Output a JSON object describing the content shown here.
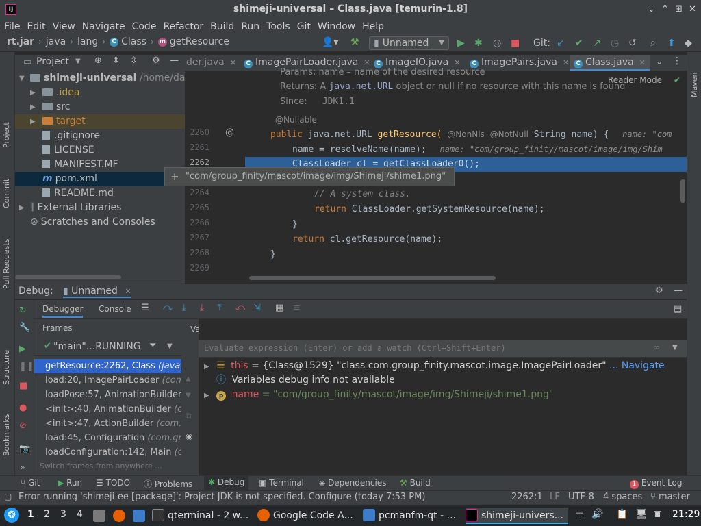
{
  "window": {
    "title": "shimeji-universal – Class.java [temurin-1.8]",
    "app_icon": "IJ"
  },
  "menu": [
    "File",
    "Edit",
    "View",
    "Navigate",
    "Code",
    "Refactor",
    "Build",
    "Run",
    "Tools",
    "Git",
    "Window",
    "Help"
  ],
  "breadcrumb": {
    "items": [
      "rt.jar",
      "java",
      "lang",
      "Class",
      "getResource"
    ]
  },
  "toolbar": {
    "run_config": "Unnamed",
    "git_label": "Git:"
  },
  "left_strip": [
    "Project",
    "Commit",
    "Pull Requests",
    "Structure",
    "Bookmarks"
  ],
  "right_strip": [
    "Maven"
  ],
  "project": {
    "header": "Project",
    "tree": [
      {
        "label": "shimeji-universal",
        "detail": "/home/dartz",
        "type": "root"
      },
      {
        "label": ".idea",
        "type": "folder"
      },
      {
        "label": "src",
        "type": "folder"
      },
      {
        "label": "target",
        "type": "folder-excluded"
      },
      {
        "label": ".gitignore",
        "type": "file"
      },
      {
        "label": "LICENSE",
        "type": "file"
      },
      {
        "label": "MANIFEST.MF",
        "type": "file"
      },
      {
        "label": "pom.xml",
        "type": "file-selected"
      },
      {
        "label": "README.md",
        "type": "file"
      },
      {
        "label": "External Libraries",
        "type": "library"
      },
      {
        "label": "Scratches and Consoles",
        "type": "scratch"
      }
    ]
  },
  "tabs": [
    "der.java",
    "ImagePairLoader.java",
    "ImageIO.java",
    "ImagePairs.java",
    "Class.java"
  ],
  "editor": {
    "reader_mode": "Reader Mode",
    "doc_params": "Params: name – name of the desired resource",
    "doc_returns_prefix": "Returns: A",
    "doc_returns_code": "java.net.URL",
    "doc_returns_suffix": "object or null if no resource with this name is found",
    "doc_since_label": "Since:",
    "doc_since_value": "JDK1.1",
    "nullable": "@Nullable",
    "line_numbers": [
      "2260",
      "2261",
      "2262",
      "2263",
      "2264",
      "2265",
      "2266",
      "2267",
      "2268",
      "2269"
    ],
    "l2260_kw": "public",
    "l2260_type": "java.net.URL",
    "l2260_fn": "getResource(",
    "l2260_ann1": "@NonNls",
    "l2260_ann2": "@NotNull",
    "l2260_param": "String name) {",
    "l2260_hint": "name: \"com",
    "l2261_code": "name = resolveName(name);",
    "l2261_hint": "name: \"com/group_finity/mascot/image/img/Shim",
    "l2262_code": "ClassLoader cl = getClassLoader0();",
    "l2264_comment": "// A system class.",
    "l2265_kw": "return",
    "l2265_code": "ClassLoader.getSystemResource(name);",
    "l2266_code": "}",
    "l2267_kw": "return",
    "l2267_code": "cl.getResource(name);",
    "l2268_code": "}",
    "tooltip": "\"com/group_finity/mascot/image/img/Shimeji/shime1.png\""
  },
  "debug": {
    "label": "Debug:",
    "config": "Unnamed",
    "tab_debugger": "Debugger",
    "tab_console": "Console",
    "frames_title": "Frames",
    "variables_title": "Variables",
    "thread": "\"main\"...RUNNING",
    "frames": [
      {
        "method": "getResource:2262, Class",
        "cls": "(java."
      },
      {
        "method": "load:20, ImagePairLoader",
        "cls": "(com"
      },
      {
        "method": "loadPose:57, AnimationBuilder",
        "cls": ""
      },
      {
        "method": "<init>:40, AnimationBuilder",
        "cls": "(c"
      },
      {
        "method": "<init>:47, ActionBuilder",
        "cls": "(com."
      },
      {
        "method": "load:45, Configuration",
        "cls": "(com.gr"
      },
      {
        "method": "loadConfiguration:142, Main",
        "cls": "(c"
      }
    ],
    "frames_hint": "Switch frames from anywhere ...",
    "eval_placeholder": "Evaluate expression (Enter) or add a watch (Ctrl+Shift+Enter)",
    "vars": {
      "this_name": "this",
      "this_value": "= {Class@1529} \"class com.group_finity.mascot.image.ImagePairLoader\"",
      "this_nav": "... Navigate",
      "info": "Variables debug info not available",
      "p_name": "name",
      "p_value": "= \"com/group_finity/mascot/image/img/Shimeji/shime1.png\""
    }
  },
  "bottom_tools": {
    "git": "Git",
    "run": "Run",
    "todo": "TODO",
    "problems": "Problems",
    "debug": "Debug",
    "terminal": "Terminal",
    "dependencies": "Dependencies",
    "build": "Build",
    "event_count": "1",
    "event_log": "Event Log"
  },
  "status": {
    "message": "Error running 'shimeji-ee [package]': Project JDK is not specified. Configure (today 7:53 PM)",
    "position": "2262:1",
    "line_sep": "LF",
    "encoding": "UTF-8",
    "indent": "4 spaces",
    "branch": "master"
  },
  "taskbar": {
    "workspaces": [
      "1",
      "2",
      "3",
      "4"
    ],
    "tasks": [
      "qterminal - 2 w...",
      "Google Code A...",
      "pcmanfm-qt - ...",
      "shimeji-univers..."
    ],
    "clock": "21:29"
  },
  "colors": {
    "accent": "#2f65ca",
    "keyword": "#cc7832",
    "function": "#ffc66d",
    "string": "#6a8759",
    "annotation": "#bbb529",
    "error": "#db5860"
  }
}
